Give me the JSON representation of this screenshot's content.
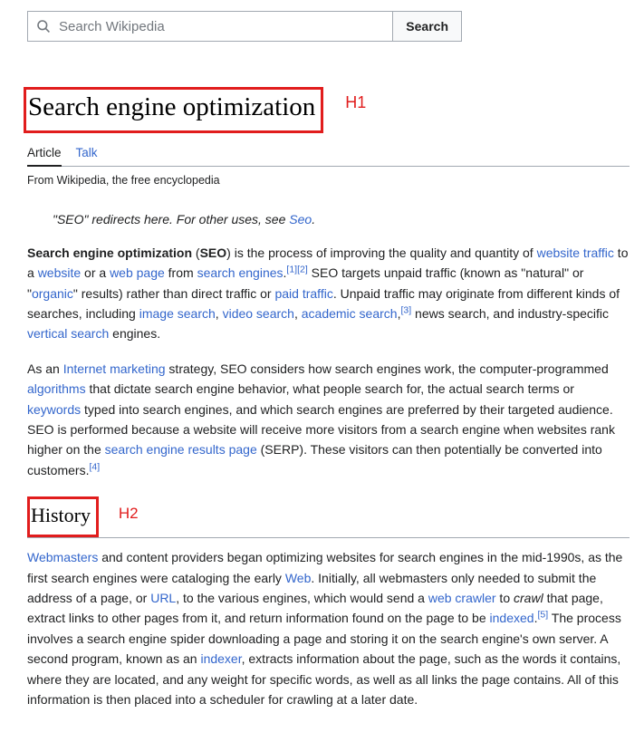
{
  "search": {
    "placeholder": "Search Wikipedia",
    "button": "Search"
  },
  "annotations": {
    "h1": "H1",
    "h2": "H2"
  },
  "title": "Search engine optimization",
  "tabs": {
    "article": "Article",
    "talk": "Talk"
  },
  "subtitle": "From Wikipedia, the free encyclopedia",
  "hatnote": {
    "prefix": "\"SEO\" redirects here. For other uses, see ",
    "link": "Seo",
    "suffix": "."
  },
  "p1": {
    "t0": "Search engine optimization",
    "t1": " (",
    "t2": "SEO",
    "t3": ") is the process of improving the quality and quantity of ",
    "l_website_traffic": "website traffic",
    "t4": " to a ",
    "l_website": "website",
    "t5": " or a ",
    "l_web_page": "web page",
    "t6": " from ",
    "l_search_engines": "search engines",
    "t7": ".",
    "ref1": "[1]",
    "ref2": "[2]",
    "t8": " SEO targets unpaid traffic (known as \"natural\" or \"",
    "l_organic": "organic",
    "t9": "\" results) rather than direct traffic or ",
    "l_paid_traffic": "paid traffic",
    "t10": ". Unpaid traffic may originate from different kinds of searches, including ",
    "l_image_search": "image search",
    "t11": ", ",
    "l_video_search": "video search",
    "t12": ", ",
    "l_academic_search": "academic search",
    "t13": ",",
    "ref3": "[3]",
    "t14": " news search, and industry-specific ",
    "l_vertical_search": "vertical search",
    "t15": " engines."
  },
  "p2": {
    "t0": "As an ",
    "l_internet_marketing": "Internet marketing",
    "t1": " strategy, SEO considers how search engines work, the computer-programmed ",
    "l_algorithms": "algorithms",
    "t2": " that dictate search engine behavior, what people search for, the actual search terms or ",
    "l_keywords": "keywords",
    "t3": " typed into search engines, and which search engines are preferred by their targeted audience. SEO is performed because a website will receive more visitors from a search engine when websites rank higher on the ",
    "l_serp": "search engine results page",
    "t4": " (SERP). These visitors can then potentially be converted into customers.",
    "ref4": "[4]"
  },
  "h2": "History",
  "p3": {
    "l_webmasters": "Webmasters",
    "t0": " and content providers began optimizing websites for search engines in the mid-1990s, as the first search engines were cataloging the early ",
    "l_web": "Web",
    "t1": ". Initially, all webmasters only needed to submit the address of a page, or ",
    "l_url": "URL",
    "t2": ", to the various engines, which would send a ",
    "l_web_crawler": "web crawler",
    "t3": " to ",
    "i_crawl": "crawl",
    "t4": " that page, extract links to other pages from it, and return information found on the page to be ",
    "l_indexed": "indexed",
    "t5": ".",
    "ref5": "[5]",
    "t6": " The process involves a search engine spider downloading a page and storing it on the search engine's own server. A second program, known as an ",
    "l_indexer": "indexer",
    "t7": ", extracts information about the page, such as the words it contains, where they are located, and any weight for specific words, as well as all links the page contains. All of this information is then placed into a scheduler for crawling at a later date."
  }
}
